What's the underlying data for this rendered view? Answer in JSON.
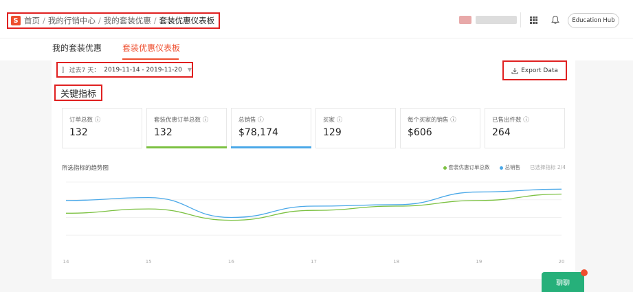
{
  "header": {
    "logo": "S",
    "breadcrumb": [
      "首页",
      "我的行销中心",
      "我的套装优惠",
      "套装优惠仪表板"
    ],
    "education_hub": "Education Hub"
  },
  "tabs": [
    {
      "label": "我的套装优惠",
      "active": false
    },
    {
      "label": "套装优惠仪表板",
      "active": true
    }
  ],
  "filter": {
    "prefix": "过去7 天：",
    "range": "2019-11-14 - 2019-11-20"
  },
  "export_label": "Export Data",
  "section_title": "关键指标",
  "metrics": [
    {
      "label": "订单总数 ⓘ",
      "value": "132",
      "accent": ""
    },
    {
      "label": "套装优惠订单总数 ⓘ",
      "value": "132",
      "accent": "#7cc142"
    },
    {
      "label": "总销售 ⓘ",
      "value": "$78,174",
      "accent": "#4aa8e8"
    },
    {
      "label": "买家 ⓘ",
      "value": "129",
      "accent": ""
    },
    {
      "label": "每个买家的销售 ⓘ",
      "value": "$606",
      "accent": ""
    },
    {
      "label": "已售出件数 ⓘ",
      "value": "264",
      "accent": ""
    }
  ],
  "trend": {
    "title": "所选指标的趋势图",
    "legend": [
      {
        "label": "套装优惠订单总数",
        "color": "#7cc142"
      },
      {
        "label": "总销售",
        "color": "#4aa8e8"
      }
    ],
    "selected": "已选择指标 2/4"
  },
  "chart_data": {
    "type": "line",
    "x": [
      "14",
      "15",
      "16",
      "17",
      "18",
      "19",
      "20"
    ],
    "series": [
      {
        "name": "总销售",
        "color": "#4aa8e8",
        "values": [
          0.74,
          0.78,
          0.5,
          0.66,
          0.68,
          0.86,
          0.9
        ]
      },
      {
        "name": "套装优惠订单总数",
        "color": "#7cc142",
        "values": [
          0.56,
          0.62,
          0.46,
          0.6,
          0.66,
          0.74,
          0.83
        ]
      }
    ],
    "ylim": [
      0,
      1
    ],
    "grid": true
  },
  "fab_label": "聊聊"
}
